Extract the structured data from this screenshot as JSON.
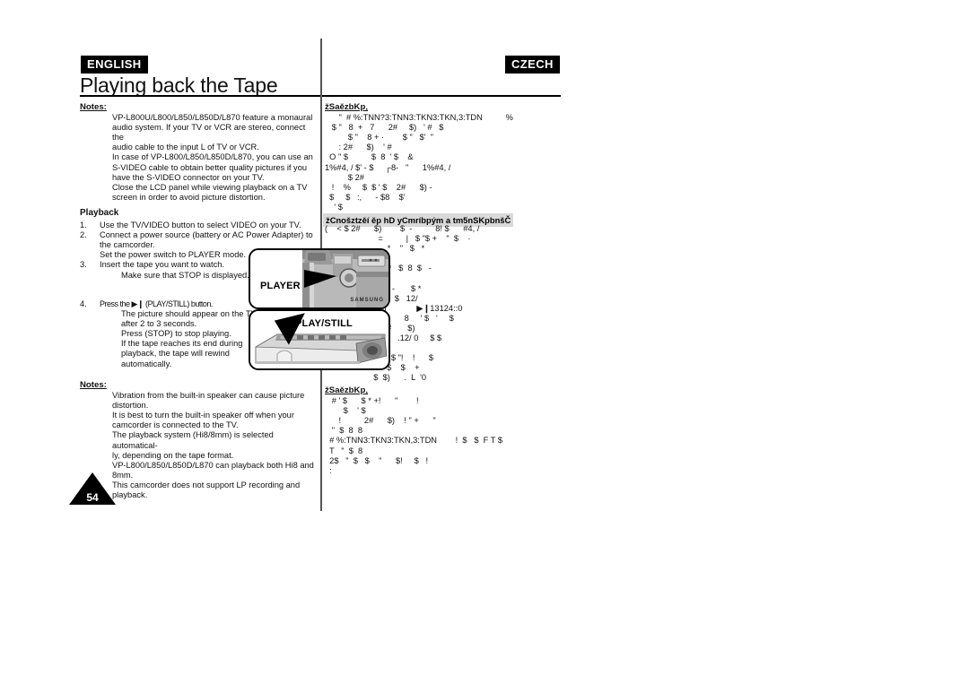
{
  "document": {
    "title": "Playing back the Tape",
    "page_number": "54",
    "left_language_badge": "ENGLISH",
    "right_language_badge": "CZECH"
  },
  "english": {
    "notes_label_top": "Notes:",
    "notes_top": [
      "VP-L800U/L800/L850/L850D/L870 feature a monaural",
      "audio system. If your TV or VCR are stereo, connect the",
      "audio cable to the input  L  of TV or VCR.",
      "In case of VP-L800/L850/L850D/L870, you can use an",
      "S-VIDEO cable to obtain better quality pictures if you",
      "have the S-VIDEO connector on your TV.",
      "Close the LCD panel while viewing playback on a TV",
      "screen in order to avoid picture distortion."
    ],
    "playback_heading": "Playback",
    "steps": [
      {
        "num": "1.",
        "lines": [
          "Use the TV/VIDEO button to select VIDEO on your TV."
        ],
        "sub": []
      },
      {
        "num": "2.",
        "lines": [
          "Connect a power source (battery or AC Power Adapter) to",
          "the camcorder."
        ],
        "sub": [
          "Set the power switch to PLAYER mode."
        ]
      },
      {
        "num": "3.",
        "lines": [
          "Insert the tape you want to watch."
        ],
        "sub": [
          "Make sure that STOP is displayed."
        ]
      },
      {
        "num": "4.",
        "lines": [
          "Press the  ▶❙ (PLAY/STILL) button."
        ],
        "sub": [
          "The picture should appear on the TV",
          "after 2 to 3 seconds.",
          "Press      (STOP) to stop playing.",
          "If the tape reaches its end during",
          "playback, the tape will rewind",
          "automatically."
        ]
      }
    ],
    "notes_label_bottom": "Notes:",
    "notes_bottom": [
      "Vibration from the built-in speaker can cause picture",
      "distortion.",
      "It is best to turn the built-in speaker off when your",
      "camcorder is connected to the TV.",
      "The playback system (Hi8/8mm) is selected automatical-",
      "ly, depending on the tape format.",
      "VP-L800/L850/L850D/L870 can playback both Hi8 and",
      "8mm.",
      "This camcorder does not support LP recording and",
      "playback."
    ]
  },
  "czech": {
    "notes_label_top": "žSaězbKp‚",
    "notes_top": [
      "      \"  # %:TNN?3:TNN3:TKN3:TKN,3:TDN          %",
      "   $ \"   8  +   7      2#     $)   ' #   $",
      "          $ \"    8 + ·        $ \"   $'  \"",
      "      : 2#      $)    ' #",
      "  O \" $          $  8  ' $    &",
      "1%#4, / $' - $     ┌8-   \"      1%#4, /",
      "          $ 2#",
      "   !    %     $  $ ' $    2#      $) -",
      "  $     $   :‚      - $8    $'",
      "    ' $"
    ],
    "section_bar": "žCnošztzěí ěp hD yCmríbpým a tm5nSKpbnšČ",
    "body": [
      "(    < $ 2#      $)        $  -          8! $      #4, /",
      "                       =          |   $ \"$ +    \"  $    ·",
      "                           *    \"   $   *",
      "                    : E",
      "          5   #     *    *   $  8  $   -",
      "               !     !",
      "                  •••)      -       $ *",
      "                ' $   $  *  $   12/",
      "     6   1     *     $)             ▶❙13124::0",
      "               ;$ = % 5      8     ' $   '     $",
      "                ' $     2#       $)",
      "            1     *           .12/ 0     $ $",
      "                  !",
      "              ,  * %      $ \"!    !      $",
      "                 - \" \"    $    $    +",
      "                     $  $)      .  L  '0"
    ],
    "notes_label_bottom": "žSaězbKp‚",
    "notes_bottom": [
      "   # ' $      $ * +!      \"        !",
      "        $    ' $",
      "      !          2#      $)    ! \" +      \"",
      "   \"  $  8  8",
      "  # %:TNN3:TKN3:TKN,3:TDN        !  $   $  F T $",
      "  T   \"  $  8",
      "  2$   \"  $   $    \"      $!     $   !",
      "  :"
    ]
  },
  "illustrations": [
    {
      "label": "PLAYER",
      "brand": "SAMSUNG"
    },
    {
      "label": "PLAY/STILL",
      "brand": ""
    }
  ]
}
